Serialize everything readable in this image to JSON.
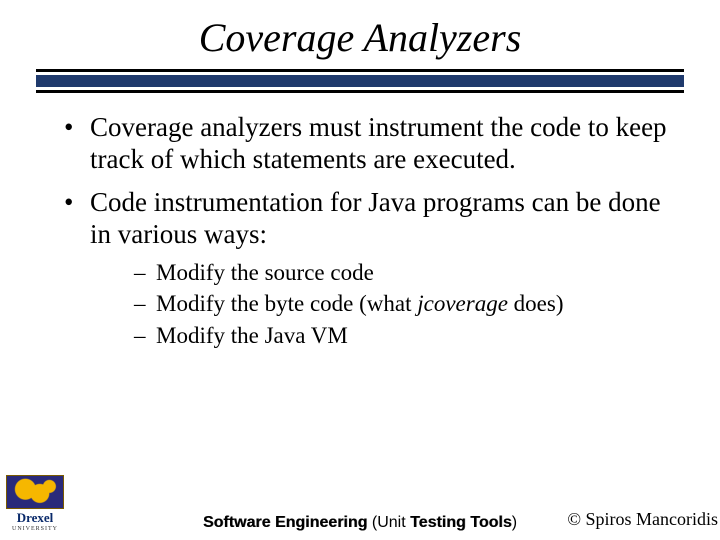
{
  "title": "Coverage Analyzers",
  "bullets": [
    {
      "text": "Coverage analyzers must instrument the code to keep track of which statements are executed."
    },
    {
      "text": "Code instrumentation for Java programs can be done in various ways:"
    }
  ],
  "sub_bullets": [
    {
      "text": "Modify the source code"
    },
    {
      "prefix": "Modify the byte code (what ",
      "em": "jcoverage",
      "suffix": " does)"
    },
    {
      "text": "Modify the Java VM"
    }
  ],
  "footer": {
    "center_strong": "Software Engineering ",
    "center_plain_1": "(Unit ",
    "center_strong_2": "Testing Tools",
    "center_plain_2": ")",
    "right": "© Spiros Mancoridis"
  },
  "logo": {
    "name": "Drexel",
    "sub": "UNIVERSITY"
  }
}
